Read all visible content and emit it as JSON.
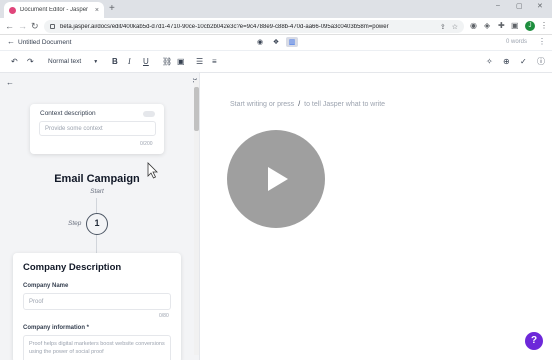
{
  "browser": {
    "tab_title": "Document Editor - Jasper",
    "tab_close": "×",
    "new_tab": "+",
    "url": "beta.jasper.ai/docs/edit/400kab5d-d7d1-4710-90ce-10cb2b042e3c?e=9c4788e9-c88b-470d-aa66-095a3c0403b58m=power",
    "win_min": "–",
    "win_max": "▢",
    "win_close": "✕",
    "avatar_letter": "J"
  },
  "header": {
    "back_symbol": "←",
    "doc_title": "Untitled Document",
    "word_count": "0 words",
    "more_symbol": "⋮"
  },
  "toolbar": {
    "undo": "↶",
    "redo": "↷",
    "text_style": "Normal text",
    "bold": "B",
    "italic": "I",
    "underline": "U"
  },
  "panel": {
    "back_symbol": "←",
    "close_symbol": "✕",
    "context": {
      "label": "Context description",
      "placeholder": "Provide some context",
      "count": "0/200"
    },
    "campaign_title": "Email Campaign",
    "campaign_start": "Start",
    "step_label": "Step",
    "step_number": "1",
    "company": {
      "title": "Company Description",
      "name_label": "Company Name",
      "name_placeholder": "Proof",
      "name_count": "0/80",
      "info_label": "Company information *",
      "info_placeholder": "Proof helps digital marketers boost website conversions using the power of social proof"
    }
  },
  "editor": {
    "placeholder_left": "Start writing or press",
    "placeholder_slash": "/",
    "placeholder_right": "to tell Jasper what to write"
  },
  "help_label": "?"
}
